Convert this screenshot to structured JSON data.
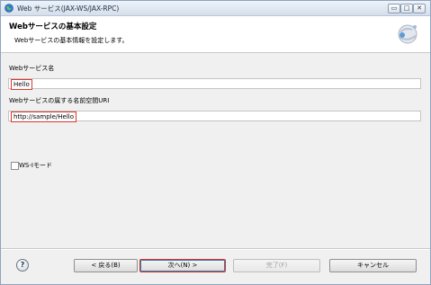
{
  "window": {
    "title": "Web サービス(JAX-WS/JAX-RPC)"
  },
  "banner": {
    "title": "Webサービスの基本設定",
    "description": "Webサービスの基本情報を設定します。"
  },
  "form": {
    "service_name_label": "Webサービス名",
    "service_name_value": "Hello",
    "namespace_label": "Webサービスの属する名前空間URI",
    "namespace_value": "http://sample/Hello",
    "wsi_label": "WS-Iモード",
    "wsi_checked": false
  },
  "buttons": {
    "help": "?",
    "back": "< 戻る(B)",
    "next": "次へ(N) >",
    "finish": "完了(F)",
    "cancel": "キャンセル"
  },
  "colors": {
    "highlight": "#e0342d",
    "titlebar": "#d5deea"
  },
  "icons": {
    "app": "globe-icon",
    "wizard": "web-service-wizard-icon",
    "help": "help-icon"
  }
}
